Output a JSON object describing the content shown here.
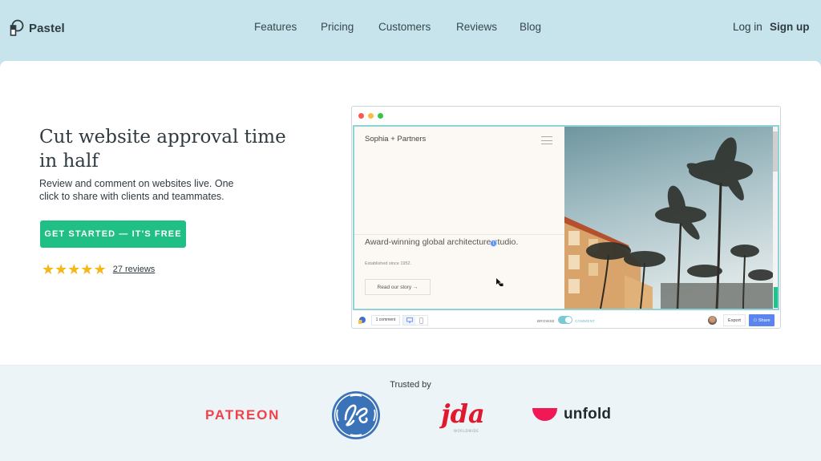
{
  "header": {
    "logo_text": "Pastel",
    "nav": [
      {
        "label": "Features"
      },
      {
        "label": "Pricing"
      },
      {
        "label": "Customers"
      },
      {
        "label": "Reviews"
      },
      {
        "label": "Blog"
      }
    ],
    "login_label": "Log in",
    "signup_label": "Sign up"
  },
  "hero": {
    "headline": "Cut website approval time in half",
    "subtext": "Review and comment on websites live. One click to share with clients and teammates.",
    "cta_label": "GET STARTED — IT'S FREE",
    "rating": {
      "stars": 5,
      "max": 5,
      "reviews_label": "27 reviews"
    }
  },
  "mockup": {
    "window_dots": [
      "#fc5753",
      "#fdbc40",
      "#33c748"
    ],
    "site": {
      "name": "Sophia + Partners",
      "tagline": "Award-winning global architecture studio.",
      "established": "Established since 1952.",
      "story_button": "Read our story →",
      "comment_pin": "1"
    },
    "toolbar": {
      "comment_count": "1 comment",
      "browse_label": "BROWSE",
      "comment_label": "COMMENT",
      "mode": "comment",
      "export_label": "Export",
      "share_label": "Share"
    }
  },
  "trusted": {
    "title": "Trusted by",
    "logos": [
      {
        "name": "PATREON",
        "color": "#f0424a"
      },
      {
        "name": "GE",
        "color": "#3b73b9"
      },
      {
        "name": "jda",
        "sub": "WORLDWIDE",
        "color": "#e0192e"
      },
      {
        "name": "unfold",
        "color": "#f01955"
      }
    ]
  },
  "colors": {
    "header_bg": "#c7e4ec",
    "cta": "#1fbf86",
    "star": "#f6b816",
    "share": "#5b84ee",
    "viewport_border": "#8fd3d8"
  }
}
